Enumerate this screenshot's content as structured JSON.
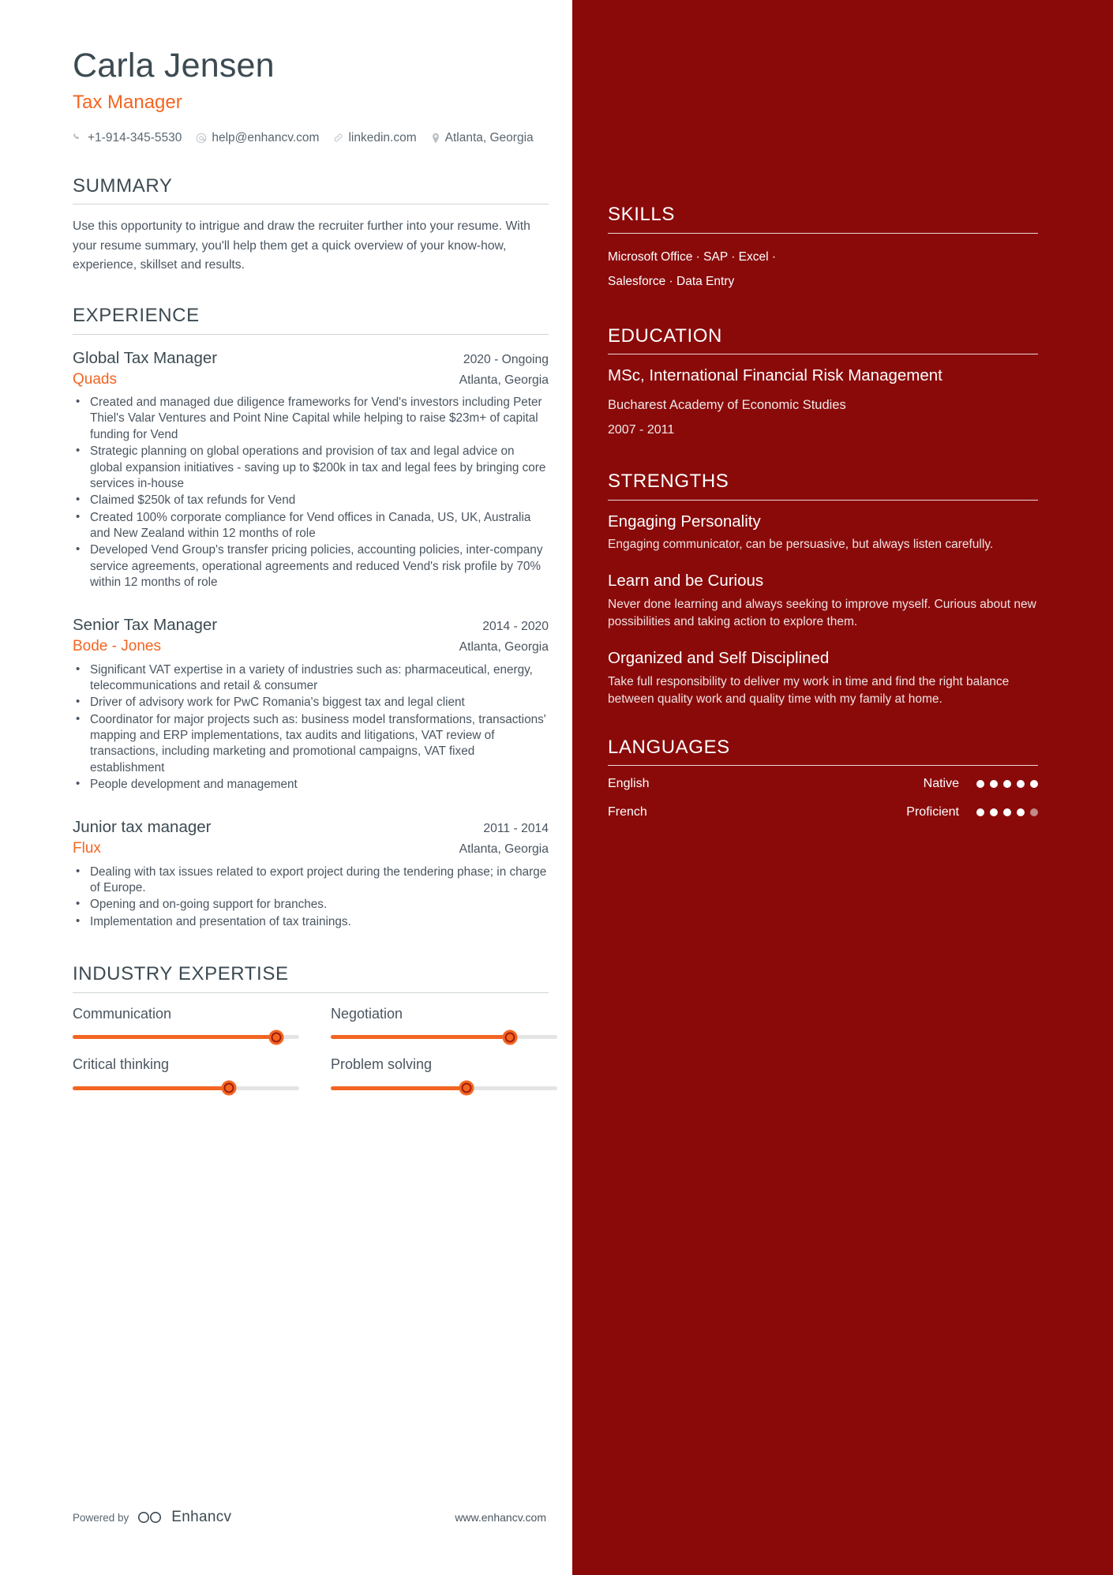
{
  "colors": {
    "accent": "#f26522",
    "sidebar_bg": "#8a0a0a",
    "heading": "#3c4a52",
    "body_text": "#4a5560"
  },
  "header": {
    "name": "Carla Jensen",
    "job_title": "Tax Manager",
    "contacts": [
      {
        "icon": "phone-icon",
        "value": "+1-914-345-5530"
      },
      {
        "icon": "email-icon",
        "value": "help@enhancv.com"
      },
      {
        "icon": "link-icon",
        "value": "linkedin.com"
      },
      {
        "icon": "location-icon",
        "value": "Atlanta, Georgia"
      }
    ]
  },
  "summary": {
    "title": "SUMMARY",
    "text": "Use this opportunity to intrigue and draw the recruiter further into your resume. With your resume summary, you'll help them get a quick overview of your know-how, experience, skillset and results."
  },
  "experience": {
    "title": "EXPERIENCE",
    "jobs": [
      {
        "role": "Global Tax Manager",
        "dates": "2020 - Ongoing",
        "company": "Quads",
        "location": "Atlanta, Georgia",
        "bullets": [
          "Created and managed due diligence frameworks for Vend's investors including Peter Thiel's Valar Ventures and Point Nine Capital while helping to raise $23m+ of capital funding for Vend",
          "Strategic planning on global operations and provision of tax and legal advice on global expansion initiatives - saving up to $200k in tax and legal fees by bringing core services in-house",
          "Claimed $250k of tax refunds for Vend",
          "Created 100% corporate compliance for Vend offices in Canada, US, UK, Australia and New Zealand within 12 months of role",
          "Developed Vend Group's transfer pricing policies, accounting policies, inter-company service agreements, operational agreements and reduced Vend's risk profile by 70% within 12 months of role"
        ]
      },
      {
        "role": "Senior Tax Manager",
        "dates": "2014 - 2020",
        "company": "Bode - Jones",
        "location": "Atlanta, Georgia",
        "bullets": [
          "Significant VAT expertise in a variety of industries such as: pharmaceutical, energy, telecommunications and retail & consumer",
          "Driver of advisory work for PwC Romania's biggest tax and legal client",
          "Coordinator for major projects such as: business model transformations, transactions' mapping and ERP implementations, tax audits and litigations, VAT review of transactions, including marketing and promotional campaigns, VAT fixed establishment",
          "People development and management"
        ]
      },
      {
        "role": "Junior tax manager",
        "dates": "2011 - 2014",
        "company": "Flux",
        "location": "Atlanta, Georgia",
        "bullets": [
          "Dealing with tax issues related to export project during the tendering phase; in charge of Europe.",
          "Opening and on-going support for branches.",
          "Implementation and presentation of tax trainings."
        ]
      }
    ]
  },
  "industry_expertise": {
    "title": "INDUSTRY EXPERTISE",
    "items": [
      {
        "label": "Communication",
        "percent": 90
      },
      {
        "label": "Negotiation",
        "percent": 79
      },
      {
        "label": "Critical thinking",
        "percent": 69
      },
      {
        "label": "Problem solving",
        "percent": 60
      }
    ]
  },
  "footer": {
    "powered_by": "Powered by",
    "brand": "Enhancv",
    "website": "www.enhancv.com"
  },
  "sidebar": {
    "skills": {
      "title": "SKILLS",
      "line1": "Microsoft Office · SAP · Excel ·",
      "line2": "Salesforce · Data Entry"
    },
    "education": {
      "title": "EDUCATION",
      "degree": "MSc, International Financial Risk Management",
      "school": "Bucharest Academy of Economic Studies",
      "dates": "2007 - 2011"
    },
    "strengths": {
      "title": "STRENGTHS",
      "items": [
        {
          "title": "Engaging Personality",
          "desc": "Engaging communicator, can be persuasive, but always listen carefully."
        },
        {
          "title": "Learn and be Curious",
          "desc": "Never done learning and always seeking to improve myself. Curious about new possibilities and taking action to explore them."
        },
        {
          "title": "Organized and Self Disciplined",
          "desc": "Take full responsibility to deliver my work in time and find the right balance between quality work and quality time with my family at home."
        }
      ]
    },
    "languages": {
      "title": "LANGUAGES",
      "items": [
        {
          "name": "English",
          "level": "Native",
          "dots_filled": 5,
          "dots_total": 5
        },
        {
          "name": "French",
          "level": "Proficient",
          "dots_filled": 4,
          "dots_total": 5
        }
      ]
    }
  }
}
